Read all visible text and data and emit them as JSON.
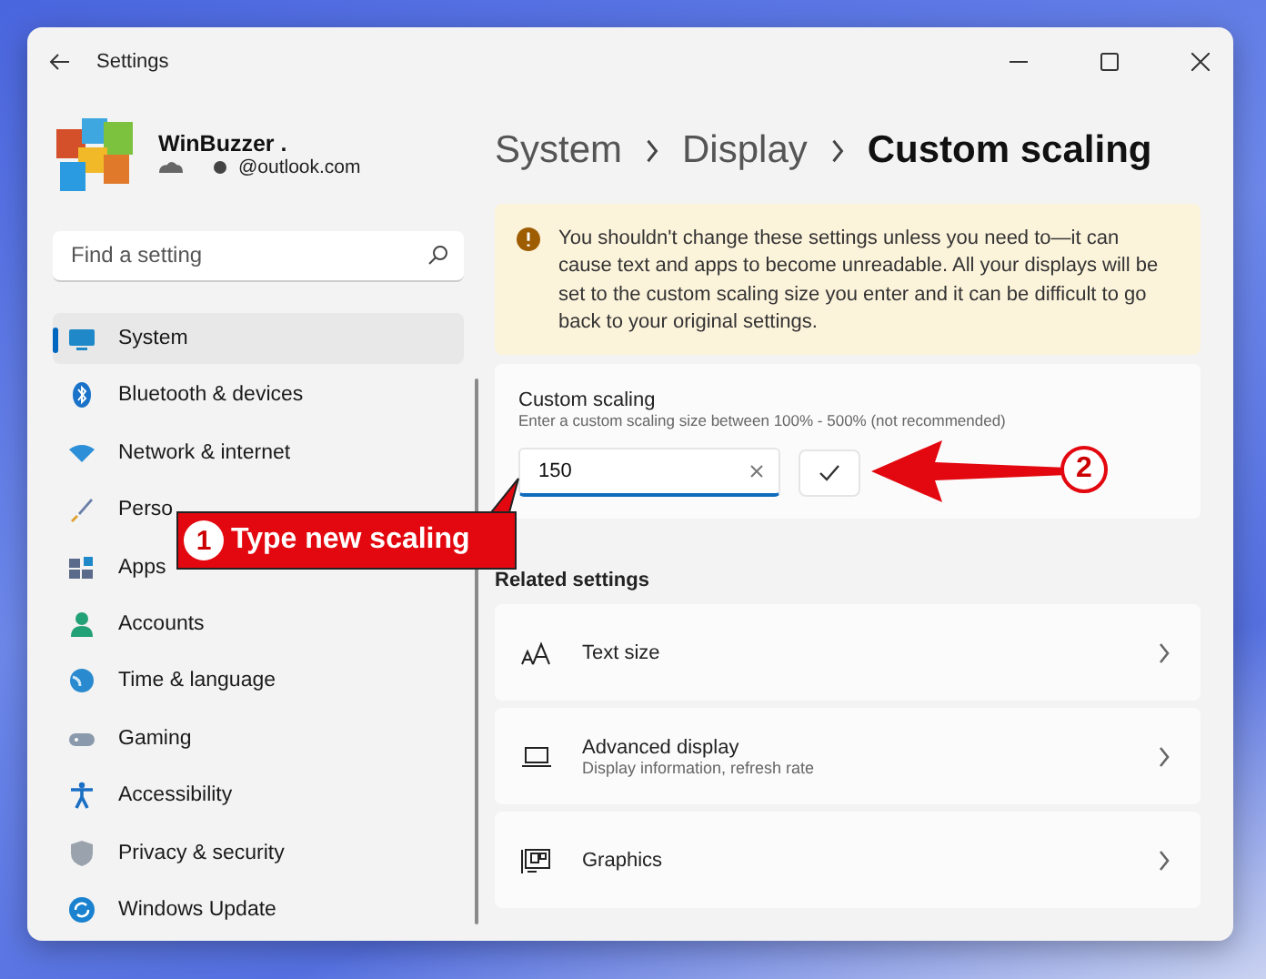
{
  "window": {
    "title": "Settings"
  },
  "profile": {
    "name": "WinBuzzer .",
    "email": "@outlook.com"
  },
  "search": {
    "placeholder": "Find a setting"
  },
  "nav": [
    {
      "kind": "system",
      "label": "System",
      "selected": true
    },
    {
      "kind": "bluetooth",
      "label": "Bluetooth & devices",
      "selected": false
    },
    {
      "kind": "network",
      "label": "Network & internet",
      "selected": false
    },
    {
      "kind": "personalization",
      "label": "Perso",
      "selected": false
    },
    {
      "kind": "apps",
      "label": "Apps",
      "selected": false
    },
    {
      "kind": "accounts",
      "label": "Accounts",
      "selected": false
    },
    {
      "kind": "time",
      "label": "Time & language",
      "selected": false
    },
    {
      "kind": "gaming",
      "label": "Gaming",
      "selected": false
    },
    {
      "kind": "accessibility",
      "label": "Accessibility",
      "selected": false
    },
    {
      "kind": "privacy",
      "label": "Privacy & security",
      "selected": false
    },
    {
      "kind": "update",
      "label": "Windows Update",
      "selected": false
    }
  ],
  "breadcrumb": [
    "System",
    "Display",
    "Custom scaling"
  ],
  "warning": {
    "text": "You shouldn't change these settings unless you need to—it can cause text and apps to become unreadable. All your displays will be set to the custom scaling size you enter and it can be difficult to go back to your original settings."
  },
  "custom_scaling": {
    "title": "Custom scaling",
    "description": "Enter a custom scaling size between 100% - 500% (not recommended)",
    "value": "150"
  },
  "related": {
    "heading": "Related settings",
    "items": [
      {
        "kind": "text-size",
        "title": "Text size"
      },
      {
        "kind": "advanced-display",
        "title": "Advanced display",
        "subtitle": "Display information, refresh rate"
      },
      {
        "kind": "graphics",
        "title": "Graphics"
      }
    ]
  },
  "annotations": [
    {
      "number": "1",
      "text": "Type new scaling"
    },
    {
      "number": "2"
    }
  ]
}
